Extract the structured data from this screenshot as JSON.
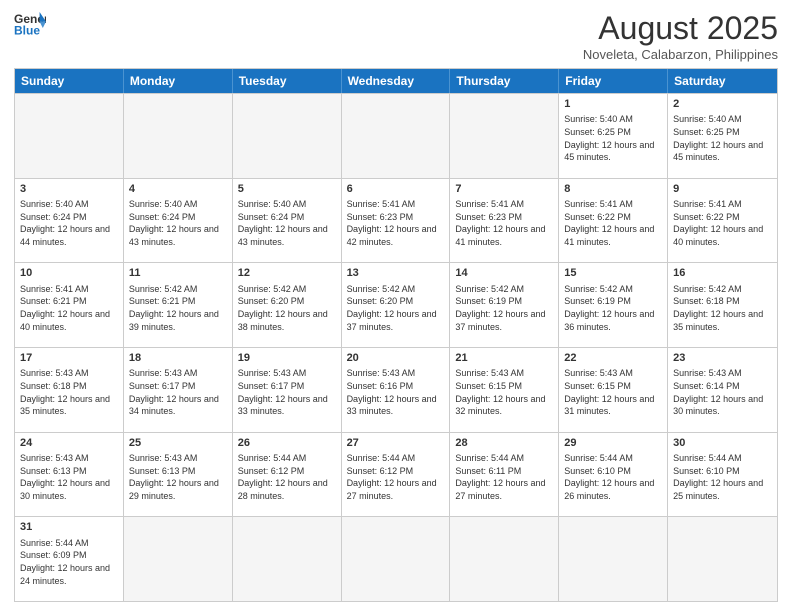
{
  "header": {
    "logo_general": "General",
    "logo_blue": "Blue",
    "month_year": "August 2025",
    "location": "Noveleta, Calabarzon, Philippines"
  },
  "days_of_week": [
    "Sunday",
    "Monday",
    "Tuesday",
    "Wednesday",
    "Thursday",
    "Friday",
    "Saturday"
  ],
  "weeks": [
    [
      {
        "day": "",
        "empty": true
      },
      {
        "day": "",
        "empty": true
      },
      {
        "day": "",
        "empty": true
      },
      {
        "day": "",
        "empty": true
      },
      {
        "day": "",
        "empty": true
      },
      {
        "day": "1",
        "sunrise": "5:40 AM",
        "sunset": "6:25 PM",
        "daylight": "12 hours and 45 minutes."
      },
      {
        "day": "2",
        "sunrise": "5:40 AM",
        "sunset": "6:25 PM",
        "daylight": "12 hours and 45 minutes."
      }
    ],
    [
      {
        "day": "3",
        "sunrise": "5:40 AM",
        "sunset": "6:24 PM",
        "daylight": "12 hours and 44 minutes."
      },
      {
        "day": "4",
        "sunrise": "5:40 AM",
        "sunset": "6:24 PM",
        "daylight": "12 hours and 43 minutes."
      },
      {
        "day": "5",
        "sunrise": "5:40 AM",
        "sunset": "6:24 PM",
        "daylight": "12 hours and 43 minutes."
      },
      {
        "day": "6",
        "sunrise": "5:41 AM",
        "sunset": "6:23 PM",
        "daylight": "12 hours and 42 minutes."
      },
      {
        "day": "7",
        "sunrise": "5:41 AM",
        "sunset": "6:23 PM",
        "daylight": "12 hours and 41 minutes."
      },
      {
        "day": "8",
        "sunrise": "5:41 AM",
        "sunset": "6:22 PM",
        "daylight": "12 hours and 41 minutes."
      },
      {
        "day": "9",
        "sunrise": "5:41 AM",
        "sunset": "6:22 PM",
        "daylight": "12 hours and 40 minutes."
      }
    ],
    [
      {
        "day": "10",
        "sunrise": "5:41 AM",
        "sunset": "6:21 PM",
        "daylight": "12 hours and 40 minutes."
      },
      {
        "day": "11",
        "sunrise": "5:42 AM",
        "sunset": "6:21 PM",
        "daylight": "12 hours and 39 minutes."
      },
      {
        "day": "12",
        "sunrise": "5:42 AM",
        "sunset": "6:20 PM",
        "daylight": "12 hours and 38 minutes."
      },
      {
        "day": "13",
        "sunrise": "5:42 AM",
        "sunset": "6:20 PM",
        "daylight": "12 hours and 37 minutes."
      },
      {
        "day": "14",
        "sunrise": "5:42 AM",
        "sunset": "6:19 PM",
        "daylight": "12 hours and 37 minutes."
      },
      {
        "day": "15",
        "sunrise": "5:42 AM",
        "sunset": "6:19 PM",
        "daylight": "12 hours and 36 minutes."
      },
      {
        "day": "16",
        "sunrise": "5:42 AM",
        "sunset": "6:18 PM",
        "daylight": "12 hours and 35 minutes."
      }
    ],
    [
      {
        "day": "17",
        "sunrise": "5:43 AM",
        "sunset": "6:18 PM",
        "daylight": "12 hours and 35 minutes."
      },
      {
        "day": "18",
        "sunrise": "5:43 AM",
        "sunset": "6:17 PM",
        "daylight": "12 hours and 34 minutes."
      },
      {
        "day": "19",
        "sunrise": "5:43 AM",
        "sunset": "6:17 PM",
        "daylight": "12 hours and 33 minutes."
      },
      {
        "day": "20",
        "sunrise": "5:43 AM",
        "sunset": "6:16 PM",
        "daylight": "12 hours and 33 minutes."
      },
      {
        "day": "21",
        "sunrise": "5:43 AM",
        "sunset": "6:15 PM",
        "daylight": "12 hours and 32 minutes."
      },
      {
        "day": "22",
        "sunrise": "5:43 AM",
        "sunset": "6:15 PM",
        "daylight": "12 hours and 31 minutes."
      },
      {
        "day": "23",
        "sunrise": "5:43 AM",
        "sunset": "6:14 PM",
        "daylight": "12 hours and 30 minutes."
      }
    ],
    [
      {
        "day": "24",
        "sunrise": "5:43 AM",
        "sunset": "6:13 PM",
        "daylight": "12 hours and 30 minutes."
      },
      {
        "day": "25",
        "sunrise": "5:43 AM",
        "sunset": "6:13 PM",
        "daylight": "12 hours and 29 minutes."
      },
      {
        "day": "26",
        "sunrise": "5:44 AM",
        "sunset": "6:12 PM",
        "daylight": "12 hours and 28 minutes."
      },
      {
        "day": "27",
        "sunrise": "5:44 AM",
        "sunset": "6:12 PM",
        "daylight": "12 hours and 27 minutes."
      },
      {
        "day": "28",
        "sunrise": "5:44 AM",
        "sunset": "6:11 PM",
        "daylight": "12 hours and 27 minutes."
      },
      {
        "day": "29",
        "sunrise": "5:44 AM",
        "sunset": "6:10 PM",
        "daylight": "12 hours and 26 minutes."
      },
      {
        "day": "30",
        "sunrise": "5:44 AM",
        "sunset": "6:10 PM",
        "daylight": "12 hours and 25 minutes."
      }
    ],
    [
      {
        "day": "31",
        "sunrise": "5:44 AM",
        "sunset": "6:09 PM",
        "daylight": "12 hours and 24 minutes."
      },
      {
        "day": "",
        "empty": true
      },
      {
        "day": "",
        "empty": true
      },
      {
        "day": "",
        "empty": true
      },
      {
        "day": "",
        "empty": true
      },
      {
        "day": "",
        "empty": true
      },
      {
        "day": "",
        "empty": true
      }
    ]
  ]
}
